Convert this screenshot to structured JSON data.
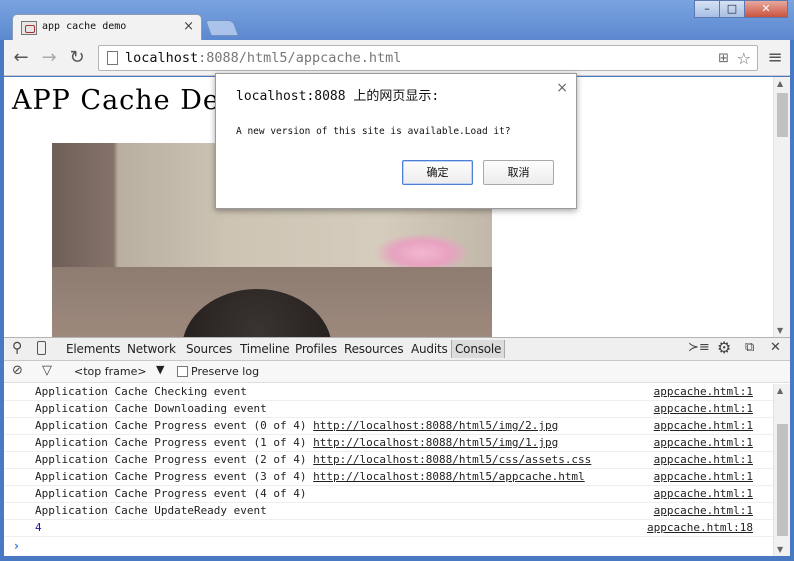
{
  "tab": {
    "title": "app cache demo",
    "close": "×"
  },
  "window_controls": {
    "minimize": "–",
    "maximize": "□",
    "close": "✕"
  },
  "toolbar": {
    "url_host": "localhost",
    "url_rest": ":8088/html5/appcache.html",
    "icons": [
      "back-icon",
      "forward-icon",
      "reload-icon",
      "page-icon",
      "translate-icon",
      "star-icon",
      "menu-icon"
    ]
  },
  "page": {
    "heading": "APP Cache Demo"
  },
  "dialog": {
    "title": "localhost:8088 上的网页显示:",
    "message": "A new version of this site is available.Load it?",
    "ok_label": "确定",
    "cancel_label": "取消",
    "close": "×"
  },
  "devtools": {
    "tabs": [
      "Elements",
      "Network",
      "Sources",
      "Timeline",
      "Profiles",
      "Resources",
      "Audits",
      "Console"
    ],
    "active_tab": "Console",
    "filter": {
      "frame": "<top frame>",
      "preserve_log": "Preserve log",
      "preserve_checked": false
    },
    "logs": [
      {
        "text": "Application Cache Checking event",
        "link": "",
        "source": "appcache.html:1"
      },
      {
        "text": "Application Cache Downloading event",
        "link": "",
        "source": "appcache.html:1"
      },
      {
        "text": "Application Cache Progress event (0 of 4) ",
        "link": "http://localhost:8088/html5/img/2.jpg",
        "source": "appcache.html:1"
      },
      {
        "text": "Application Cache Progress event (1 of 4) ",
        "link": "http://localhost:8088/html5/img/1.jpg",
        "source": "appcache.html:1"
      },
      {
        "text": "Application Cache Progress event (2 of 4) ",
        "link": "http://localhost:8088/html5/css/assets.css",
        "source": "appcache.html:1"
      },
      {
        "text": "Application Cache Progress event (3 of 4) ",
        "link": "http://localhost:8088/html5/appcache.html",
        "source": "appcache.html:1"
      },
      {
        "text": "Application Cache Progress event (4 of 4)",
        "link": "",
        "source": "appcache.html:1"
      },
      {
        "text": "Application Cache UpdateReady event",
        "link": "",
        "source": "appcache.html:1"
      },
      {
        "text": "4",
        "link": "",
        "source": "appcache.html:18"
      }
    ],
    "prompt": "›"
  }
}
